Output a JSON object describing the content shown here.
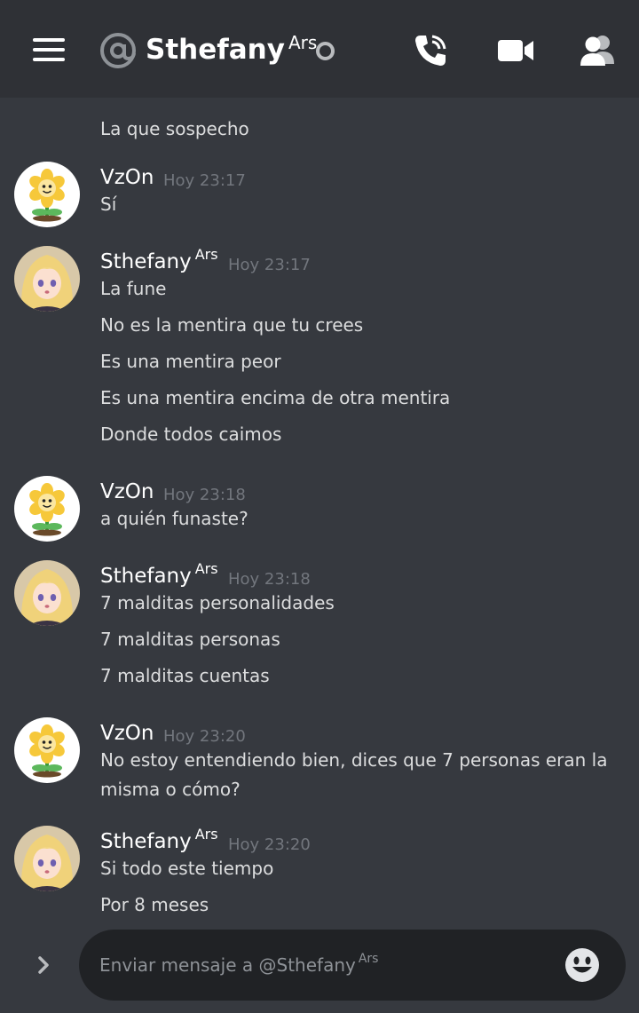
{
  "header": {
    "name": "Sthefany",
    "tag": "Ars"
  },
  "messages": {
    "partial_top": "La que sospecho",
    "groups": [
      {
        "author": "VzOn",
        "tag": "",
        "timestamp": "Hoy 23:17",
        "lines": [
          "Sí"
        ]
      },
      {
        "author": "Sthefany",
        "tag": "Ars",
        "timestamp": "Hoy 23:17",
        "lines": [
          "La fune",
          "No es la mentira que tu crees",
          "Es una mentira peor",
          "Es una mentira encima de otra mentira",
          "Donde todos caimos"
        ]
      },
      {
        "author": "VzOn",
        "tag": "",
        "timestamp": "Hoy 23:18",
        "lines": [
          "a quién funaste?"
        ]
      },
      {
        "author": "Sthefany",
        "tag": "Ars",
        "timestamp": "Hoy 23:18",
        "lines": [
          "7 malditas personalidades",
          "7 malditas personas",
          "7 malditas cuentas"
        ]
      },
      {
        "author": "VzOn",
        "tag": "",
        "timestamp": "Hoy 23:20",
        "lines": [
          "No estoy entendiendo bien, dices que 7 personas eran la",
          "misma o cómo?"
        ]
      },
      {
        "author": "Sthefany",
        "tag": "Ars",
        "timestamp": "Hoy 23:20",
        "lines": [
          "Si todo este tiempo",
          "Por 8 meses"
        ]
      }
    ]
  },
  "composer": {
    "placeholder": "Enviar mensaje a @Sthefany",
    "placeholder_tag": "Ars"
  },
  "icons": [
    "menu-icon",
    "at-icon",
    "status-icon",
    "call-icon",
    "video-icon",
    "members-icon",
    "expand-icon",
    "emoji-icon"
  ],
  "colors": {
    "background": "#36393f",
    "header": "#2f3136",
    "input": "#202225",
    "timestamp": "#72767d"
  }
}
